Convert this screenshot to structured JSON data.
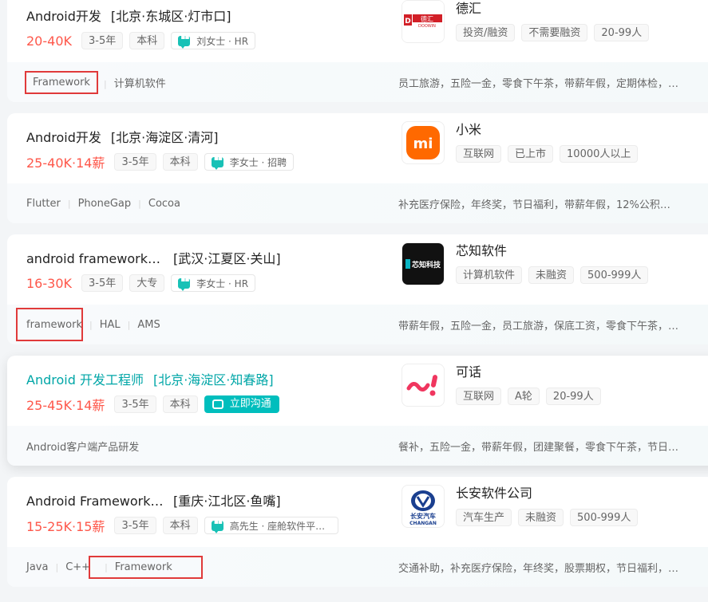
{
  "jobs": [
    {
      "title": "Android开发",
      "area": "[北京·东城区·灯市口]",
      "salary": "20-40K",
      "experience": "3-5年",
      "degree": "本科",
      "recruiter": "刘女士 · HR",
      "skills": [
        "Framework",
        "计算机软件"
      ],
      "welfare": "员工旅游，五险一金，零食下午茶，带薪年假，定期体检，…",
      "company": {
        "name": "德汇",
        "logo_text": "德汇",
        "logo_sub": "DOOWIN",
        "tags": [
          "投资/融资",
          "不需要融资",
          "20-99人"
        ]
      }
    },
    {
      "title": "Android开发",
      "area": "[北京·海淀区·清河]",
      "salary": "25-40K·14薪",
      "experience": "3-5年",
      "degree": "本科",
      "recruiter": "李女士 · 招聘",
      "skills": [
        "Flutter",
        "PhoneGap",
        "Cocoa"
      ],
      "welfare": "补充医疗保险，年终奖，节日福利，带薪年假，12%公积金…",
      "company": {
        "name": "小米",
        "logo_text": "mi",
        "tags": [
          "互联网",
          "已上市",
          "10000人以上"
        ]
      }
    },
    {
      "title": "android framework框…",
      "area": "[武汉·江夏区·关山]",
      "salary": "16-30K",
      "experience": "3-5年",
      "degree": "大专",
      "recruiter": "李女士 · HR",
      "skills": [
        "framework",
        "HAL",
        "AMS"
      ],
      "welfare": "带薪年假，五险一金，员工旅游，保底工资，零食下午茶，…",
      "company": {
        "name": "芯知软件",
        "logo_text": "芯知科技",
        "tags": [
          "计算机软件",
          "未融资",
          "500-999人"
        ]
      }
    },
    {
      "title": "Android 开发工程师",
      "area": "[北京·海淀区·知春路]",
      "salary": "25-45K·14薪",
      "experience": "3-5年",
      "degree": "本科",
      "chat_label": "立即沟通",
      "description": "Android客户端产品研发",
      "welfare": "餐补，五险一金，带薪年假，团建聚餐，零食下午茶，节日…",
      "company": {
        "name": "可话",
        "logo_text": "~!",
        "tags": [
          "互联网",
          "A轮",
          "20-99人"
        ]
      }
    },
    {
      "title": "Android Framework开…",
      "area": "[重庆·江北区·鱼嘴]",
      "salary": "15-25K·15薪",
      "experience": "3-5年",
      "degree": "本科",
      "recruiter": "高先生 · 座舱软件平台…",
      "skills": [
        "Java",
        "C++",
        "Framework"
      ],
      "welfare": "交通补助，补充医疗保险，年终奖，股票期权，节日福利，…",
      "company": {
        "name": "长安软件公司",
        "logo_text": "长安汽车",
        "logo_sub": "CHANGAN",
        "tags": [
          "汽车生产",
          "未融资",
          "500-999人"
        ]
      }
    }
  ],
  "colors": {
    "salary": "#fe574a",
    "accent": "#00bebd",
    "highlight_box": "#e03a3a"
  }
}
